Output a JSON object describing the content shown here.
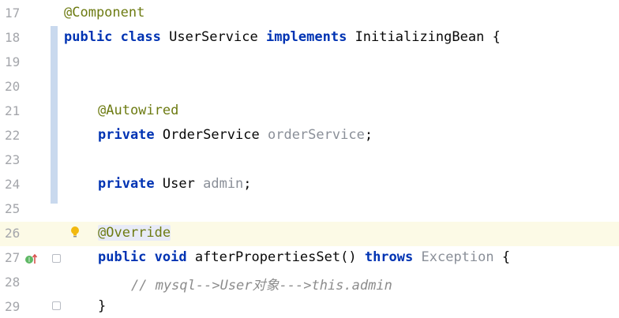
{
  "editor": {
    "lines": [
      {
        "number": "17",
        "tokens": [
          "@Component"
        ]
      },
      {
        "number": "18",
        "tokens": [
          "public",
          "class",
          "UserService",
          "implements",
          "InitializingBean",
          "{"
        ]
      },
      {
        "number": "19",
        "tokens": []
      },
      {
        "number": "20",
        "tokens": []
      },
      {
        "number": "21",
        "tokens": [
          "@Autowired"
        ]
      },
      {
        "number": "22",
        "tokens": [
          "private",
          "OrderService",
          "orderService",
          ";"
        ]
      },
      {
        "number": "23",
        "tokens": []
      },
      {
        "number": "24",
        "tokens": [
          "private",
          "User",
          "admin",
          ";"
        ]
      },
      {
        "number": "25",
        "tokens": []
      },
      {
        "number": "26",
        "tokens": [
          "@Override"
        ]
      },
      {
        "number": "27",
        "tokens": [
          "public",
          "void",
          "afterPropertiesSet()",
          "throws",
          "Exception",
          "{"
        ]
      },
      {
        "number": "28",
        "tokens": [
          "// mysql-->User对象--->this.admin"
        ]
      },
      {
        "number": "29",
        "tokens": [
          "}"
        ]
      }
    ],
    "highlighted_line": "26",
    "colors": {
      "keyword": "#0033b3",
      "annotation": "#6d7b12",
      "field": "#871094",
      "comment": "#8c8c8c",
      "line_number": "#a4a6ab",
      "current_line_bg": "#fcfae6",
      "vcs_changed_marker": "#c9d9ee"
    },
    "gutter_icons": [
      "lightbulb-icon",
      "implements-method-icon",
      "fold-icon"
    ]
  }
}
